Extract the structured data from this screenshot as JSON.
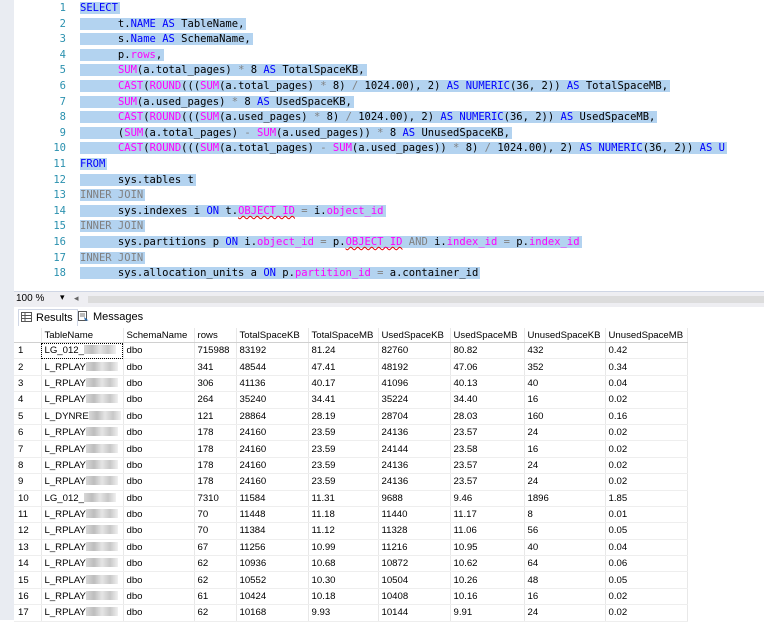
{
  "editor": {
    "lines": [
      {
        "n": "1",
        "tokens": [
          {
            "t": "SELECT",
            "c": "kw"
          }
        ]
      },
      {
        "n": "2",
        "tokens": [
          {
            "t": "      t.",
            "c": ""
          },
          {
            "t": "NAME",
            "c": "kw"
          },
          {
            "t": " AS ",
            "c": "kw"
          },
          {
            "t": "TableName,",
            "c": ""
          }
        ]
      },
      {
        "n": "3",
        "tokens": [
          {
            "t": "      s.",
            "c": ""
          },
          {
            "t": "Name",
            "c": "kw"
          },
          {
            "t": " AS ",
            "c": "kw"
          },
          {
            "t": "SchemaName,",
            "c": ""
          }
        ]
      },
      {
        "n": "4",
        "tokens": [
          {
            "t": "      p.",
            "c": ""
          },
          {
            "t": "rows",
            "c": "fn"
          },
          {
            "t": ",",
            "c": ""
          }
        ]
      },
      {
        "n": "5",
        "tokens": [
          {
            "t": "      ",
            "c": ""
          },
          {
            "t": "SUM",
            "c": "fn"
          },
          {
            "t": "(a.total_pages) ",
            "c": ""
          },
          {
            "t": "*",
            "c": "gr"
          },
          {
            "t": " 8 ",
            "c": ""
          },
          {
            "t": "AS",
            "c": "kw"
          },
          {
            "t": " TotalSpaceKB,",
            "c": ""
          }
        ]
      },
      {
        "n": "6",
        "tokens": [
          {
            "t": "      ",
            "c": ""
          },
          {
            "t": "CAST",
            "c": "fn"
          },
          {
            "t": "(",
            "c": ""
          },
          {
            "t": "ROUND",
            "c": "fn"
          },
          {
            "t": "(((",
            "c": ""
          },
          {
            "t": "SUM",
            "c": "fn"
          },
          {
            "t": "(a.total_pages) ",
            "c": ""
          },
          {
            "t": "*",
            "c": "gr"
          },
          {
            "t": " 8) ",
            "c": ""
          },
          {
            "t": "/",
            "c": "gr"
          },
          {
            "t": " 1024.00), 2) ",
            "c": ""
          },
          {
            "t": "AS NUMERIC",
            "c": "kw"
          },
          {
            "t": "(36, 2)) ",
            "c": ""
          },
          {
            "t": "AS",
            "c": "kw"
          },
          {
            "t": " TotalSpaceMB,",
            "c": ""
          }
        ]
      },
      {
        "n": "7",
        "tokens": [
          {
            "t": "      ",
            "c": ""
          },
          {
            "t": "SUM",
            "c": "fn"
          },
          {
            "t": "(a.used_pages) ",
            "c": ""
          },
          {
            "t": "*",
            "c": "gr"
          },
          {
            "t": " 8 ",
            "c": ""
          },
          {
            "t": "AS",
            "c": "kw"
          },
          {
            "t": " UsedSpaceKB,",
            "c": ""
          }
        ]
      },
      {
        "n": "8",
        "tokens": [
          {
            "t": "      ",
            "c": ""
          },
          {
            "t": "CAST",
            "c": "fn"
          },
          {
            "t": "(",
            "c": ""
          },
          {
            "t": "ROUND",
            "c": "fn"
          },
          {
            "t": "(((",
            "c": ""
          },
          {
            "t": "SUM",
            "c": "fn"
          },
          {
            "t": "(a.used_pages) ",
            "c": ""
          },
          {
            "t": "*",
            "c": "gr"
          },
          {
            "t": " 8) ",
            "c": ""
          },
          {
            "t": "/",
            "c": "gr"
          },
          {
            "t": " 1024.00), 2) ",
            "c": ""
          },
          {
            "t": "AS NUMERIC",
            "c": "kw"
          },
          {
            "t": "(36, 2)) ",
            "c": ""
          },
          {
            "t": "AS",
            "c": "kw"
          },
          {
            "t": " UsedSpaceMB,",
            "c": ""
          }
        ]
      },
      {
        "n": "9",
        "tokens": [
          {
            "t": "      (",
            "c": ""
          },
          {
            "t": "SUM",
            "c": "fn"
          },
          {
            "t": "(a.total_pages) ",
            "c": ""
          },
          {
            "t": "-",
            "c": "gr"
          },
          {
            "t": " ",
            "c": ""
          },
          {
            "t": "SUM",
            "c": "fn"
          },
          {
            "t": "(a.used_pages)) ",
            "c": ""
          },
          {
            "t": "*",
            "c": "gr"
          },
          {
            "t": " 8 ",
            "c": ""
          },
          {
            "t": "AS",
            "c": "kw"
          },
          {
            "t": " UnusedSpaceKB,",
            "c": ""
          }
        ]
      },
      {
        "n": "10",
        "tokens": [
          {
            "t": "      ",
            "c": ""
          },
          {
            "t": "CAST",
            "c": "fn"
          },
          {
            "t": "(",
            "c": ""
          },
          {
            "t": "ROUND",
            "c": "fn"
          },
          {
            "t": "(((",
            "c": ""
          },
          {
            "t": "SUM",
            "c": "fn"
          },
          {
            "t": "(a.total_pages) ",
            "c": ""
          },
          {
            "t": "-",
            "c": "gr"
          },
          {
            "t": " ",
            "c": ""
          },
          {
            "t": "SUM",
            "c": "fn"
          },
          {
            "t": "(a.used_pages)) ",
            "c": ""
          },
          {
            "t": "*",
            "c": "gr"
          },
          {
            "t": " 8) ",
            "c": ""
          },
          {
            "t": "/",
            "c": "gr"
          },
          {
            "t": " 1024.00), 2) ",
            "c": ""
          },
          {
            "t": "AS NUMERIC",
            "c": "kw"
          },
          {
            "t": "(36, 2)) ",
            "c": ""
          },
          {
            "t": "AS U",
            "c": "kw"
          }
        ]
      },
      {
        "n": "11",
        "tokens": [
          {
            "t": "FROM",
            "c": "kw"
          }
        ]
      },
      {
        "n": "12",
        "tokens": [
          {
            "t": "      sys.tables t",
            "c": ""
          }
        ]
      },
      {
        "n": "13",
        "tokens": [
          {
            "t": "INNER JOIN",
            "c": "gr"
          }
        ]
      },
      {
        "n": "14",
        "tokens": [
          {
            "t": "      sys.indexes i ",
            "c": ""
          },
          {
            "t": "ON",
            "c": "kw"
          },
          {
            "t": " t.",
            "c": ""
          },
          {
            "t": "OBJECT_ID",
            "c": "fn sq"
          },
          {
            "t": " ",
            "c": ""
          },
          {
            "t": "=",
            "c": "gr"
          },
          {
            "t": " i.",
            "c": ""
          },
          {
            "t": "object_id",
            "c": "fn"
          }
        ]
      },
      {
        "n": "15",
        "tokens": [
          {
            "t": "INNER JOIN",
            "c": "gr"
          }
        ]
      },
      {
        "n": "16",
        "tokens": [
          {
            "t": "      sys.partitions p ",
            "c": ""
          },
          {
            "t": "ON",
            "c": "kw"
          },
          {
            "t": " i.",
            "c": ""
          },
          {
            "t": "object_id",
            "c": "fn"
          },
          {
            "t": " ",
            "c": ""
          },
          {
            "t": "=",
            "c": "gr"
          },
          {
            "t": " p.",
            "c": ""
          },
          {
            "t": "OBJECT_ID",
            "c": "fn sq"
          },
          {
            "t": " ",
            "c": ""
          },
          {
            "t": "AND",
            "c": "gr"
          },
          {
            "t": " i.",
            "c": ""
          },
          {
            "t": "index_id",
            "c": "fn"
          },
          {
            "t": " ",
            "c": ""
          },
          {
            "t": "=",
            "c": "gr"
          },
          {
            "t": " p.",
            "c": ""
          },
          {
            "t": "index_id",
            "c": "fn"
          }
        ]
      },
      {
        "n": "17",
        "tokens": [
          {
            "t": "INNER JOIN",
            "c": "gr"
          }
        ]
      },
      {
        "n": "18",
        "tokens": [
          {
            "t": "      sys.allocation_units a ",
            "c": ""
          },
          {
            "t": "ON",
            "c": "kw"
          },
          {
            "t": " p.",
            "c": ""
          },
          {
            "t": "partition_id",
            "c": "fn"
          },
          {
            "t": " ",
            "c": ""
          },
          {
            "t": "=",
            "c": "gr"
          },
          {
            "t": " a.container_id",
            "c": ""
          }
        ]
      }
    ]
  },
  "zoom": {
    "level": "100 %",
    "dropdown": "▾",
    "scroll_left": "◂"
  },
  "tabs": [
    {
      "label": "Results",
      "icon": "results-grid-icon"
    },
    {
      "label": "Messages",
      "icon": "messages-icon"
    }
  ],
  "grid": {
    "columns": [
      "",
      "TableName",
      "SchemaName",
      "rows",
      "TotalSpaceKB",
      "TotalSpaceMB",
      "UsedSpaceKB",
      "UsedSpaceMB",
      "UnusedSpaceKB",
      "UnusedSpaceMB"
    ],
    "rows": [
      [
        "1",
        "LG_012_",
        "dbo",
        "715988",
        "83192",
        "81.24",
        "82760",
        "80.82",
        "432",
        "0.42"
      ],
      [
        "2",
        "L_RPLAY",
        "dbo",
        "341",
        "48544",
        "47.41",
        "48192",
        "47.06",
        "352",
        "0.34"
      ],
      [
        "3",
        "L_RPLAY",
        "dbo",
        "306",
        "41136",
        "40.17",
        "41096",
        "40.13",
        "40",
        "0.04"
      ],
      [
        "4",
        "L_RPLAY",
        "dbo",
        "264",
        "35240",
        "34.41",
        "35224",
        "34.40",
        "16",
        "0.02"
      ],
      [
        "5",
        "L_DYNRE",
        "dbo",
        "121",
        "28864",
        "28.19",
        "28704",
        "28.03",
        "160",
        "0.16"
      ],
      [
        "6",
        "L_RPLAY",
        "dbo",
        "178",
        "24160",
        "23.59",
        "24136",
        "23.57",
        "24",
        "0.02"
      ],
      [
        "7",
        "L_RPLAY",
        "dbo",
        "178",
        "24160",
        "23.59",
        "24144",
        "23.58",
        "16",
        "0.02"
      ],
      [
        "8",
        "L_RPLAY",
        "dbo",
        "178",
        "24160",
        "23.59",
        "24136",
        "23.57",
        "24",
        "0.02"
      ],
      [
        "9",
        "L_RPLAY",
        "dbo",
        "178",
        "24160",
        "23.59",
        "24136",
        "23.57",
        "24",
        "0.02"
      ],
      [
        "10",
        "LG_012_",
        "dbo",
        "7310",
        "11584",
        "11.31",
        "9688",
        "9.46",
        "1896",
        "1.85"
      ],
      [
        "11",
        "L_RPLAY",
        "dbo",
        "70",
        "11448",
        "11.18",
        "11440",
        "11.17",
        "8",
        "0.01"
      ],
      [
        "12",
        "L_RPLAY",
        "dbo",
        "70",
        "11384",
        "11.12",
        "11328",
        "11.06",
        "56",
        "0.05"
      ],
      [
        "13",
        "L_RPLAY",
        "dbo",
        "67",
        "11256",
        "10.99",
        "11216",
        "10.95",
        "40",
        "0.04"
      ],
      [
        "14",
        "L_RPLAY",
        "dbo",
        "62",
        "10936",
        "10.68",
        "10872",
        "10.62",
        "64",
        "0.06"
      ],
      [
        "15",
        "L_RPLAY",
        "dbo",
        "62",
        "10552",
        "10.30",
        "10504",
        "10.26",
        "48",
        "0.05"
      ],
      [
        "16",
        "L_RPLAY",
        "dbo",
        "61",
        "10424",
        "10.18",
        "10408",
        "10.16",
        "16",
        "0.02"
      ],
      [
        "17",
        "L_RPLAY",
        "dbo",
        "62",
        "10168",
        "9.93",
        "10144",
        "9.91",
        "24",
        "0.02"
      ]
    ]
  }
}
